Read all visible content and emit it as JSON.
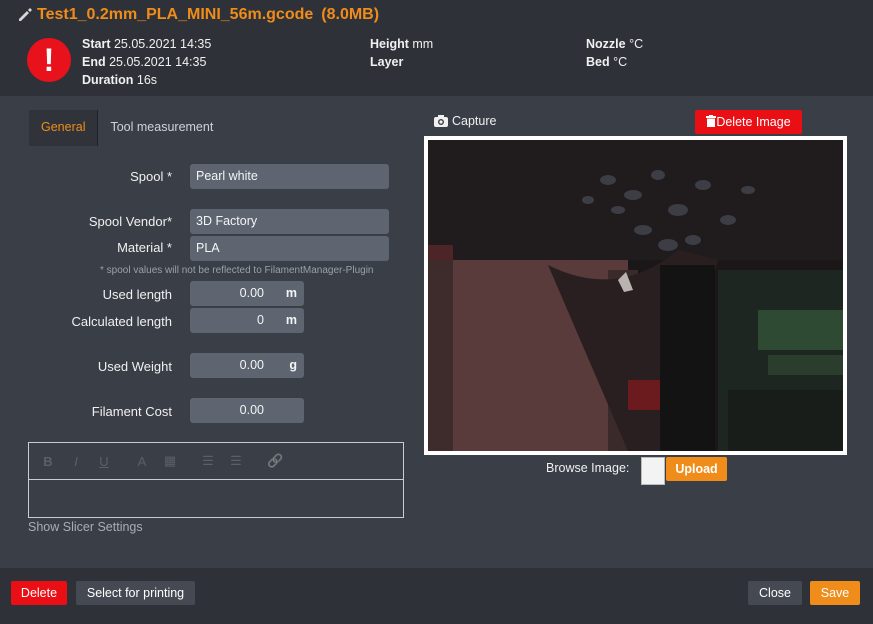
{
  "header": {
    "filename": "Test1_0.2mm_PLA_MINI_56m.gcode",
    "filesize": "(8.0MB)",
    "start_label": "Start",
    "start_value": "25.05.2021 14:35",
    "end_label": "End",
    "end_value": "25.05.2021 14:35",
    "duration_label": "Duration",
    "duration_value": "16s",
    "height_label": "Height",
    "height_unit": "mm",
    "layer_label": "Layer",
    "nozzle_label": "Nozzle",
    "nozzle_unit": "°C",
    "bed_label": "Bed",
    "bed_unit": "°C",
    "status_glyph": "!"
  },
  "tabs": [
    {
      "label": "General",
      "active": true
    },
    {
      "label": "Tool measurement",
      "active": false
    }
  ],
  "form": {
    "spool_label": "Spool *",
    "spool_value": "Pearl white",
    "vendor_label": "Spool Vendor*",
    "vendor_value": "3D Factory",
    "material_label": "Material *",
    "material_value": "PLA",
    "hint": "* spool values will not be reflected to FilamentManager-Plugin",
    "used_length_label": "Used length",
    "used_length_value": "0.00",
    "used_length_unit": "m",
    "calc_length_label": "Calculated length",
    "calc_length_value": "0",
    "calc_length_unit": "m",
    "used_weight_label": "Used Weight",
    "used_weight_value": "0.00",
    "used_weight_unit": "g",
    "cost_label": "Filament Cost",
    "cost_value": "0.00"
  },
  "editor": {
    "tools": [
      "B",
      "I",
      "U",
      "A",
      "▦",
      "☰",
      "☰",
      "🔗"
    ]
  },
  "slicer_link": "Show Slicer Settings",
  "image": {
    "capture_label": "Capture",
    "delete_label": "Delete Image",
    "browse_label": "Browse Image:",
    "upload_label": "Upload"
  },
  "footer": {
    "delete_label": "Delete",
    "select_label": "Select for printing",
    "close_label": "Close",
    "save_label": "Save"
  },
  "colors": {
    "accent": "#f08c1a",
    "danger": "#ea0f15",
    "background": "#3a3f47",
    "header_bg": "#2e3238"
  }
}
